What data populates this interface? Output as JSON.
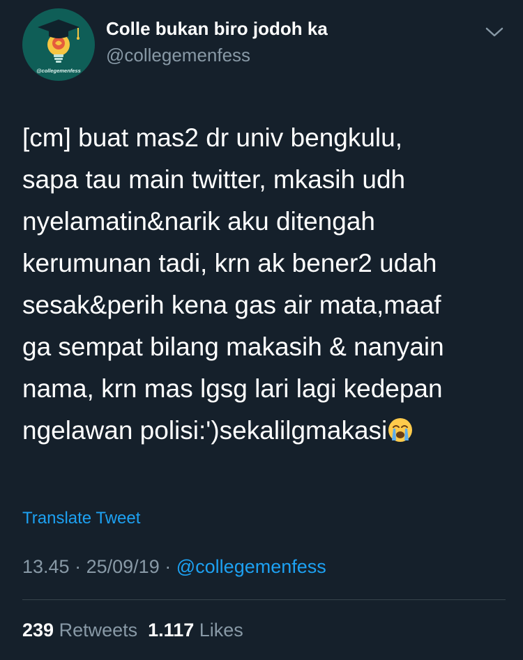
{
  "author": {
    "display_name": "Colle bukan biro jodoh ka",
    "handle": "@collegemenfess",
    "avatar_label": "@collegemenfess",
    "avatar_icon": "graduation-cap-lightbulb-icon",
    "avatar_bg": "#0f5e57"
  },
  "tweet": {
    "text": "[cm] buat mas2 dr univ bengkulu,\nsapa tau main twitter, mkasih udh\nnyelamatin&narik aku ditengah\nkerumunan tadi, krn ak bener2 udah\nsesak&perih kena gas air mata,maaf\nga sempat bilang makasih & nanyain\nnama, krn mas lgsg lari lagi kedepan\nngelawan polisi:')sekalilgmakasi",
    "trailing_emoji": "loudly-crying-face-emoji",
    "translate_label": "Translate Tweet"
  },
  "meta": {
    "time": "13.45",
    "date": "25/09/19",
    "separator": "·",
    "source": "@collegemenfess"
  },
  "stats": {
    "retweets_count": "239",
    "retweets_label": "Retweets",
    "likes_count": "1.117",
    "likes_label": "Likes"
  },
  "menu_icon": "chevron-down-icon",
  "colors": {
    "background": "#15202b",
    "text_primary": "#ffffff",
    "text_secondary": "#8899a6",
    "link": "#1da1f2",
    "divider": "#38444d"
  }
}
